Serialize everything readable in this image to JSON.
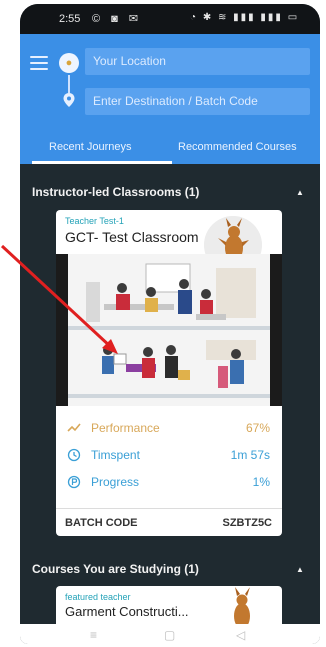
{
  "status_bar": {
    "time": "2:55"
  },
  "search": {
    "location_placeholder": "Your Location",
    "destination_placeholder": "Enter Destination / Batch Code"
  },
  "tabs": [
    {
      "label": "Recent Journeys",
      "active": true
    },
    {
      "label": "Recommended Courses",
      "active": false
    }
  ],
  "sections": {
    "instructor_led": {
      "title": "Instructor-led Classrooms (1)",
      "card": {
        "teacher": "Teacher Test-1",
        "title": "GCT- Test Classroom",
        "count": "1",
        "stats": [
          {
            "label": "Performance",
            "value": "67%"
          },
          {
            "label": "Timspent",
            "value": "1m 57s"
          },
          {
            "label": "Progress",
            "value": "1%"
          }
        ],
        "batch_label": "BATCH CODE",
        "batch_code": "SZBTZ5C"
      }
    },
    "studying": {
      "title": "Courses You are Studying (1)",
      "card": {
        "teacher": "featured teacher",
        "title": "Garment Constructi..."
      }
    }
  },
  "colors": {
    "header_blue": "#3b8fe6",
    "background_dark": "#1f2a30",
    "performance": "#d8a85a",
    "accent_teal": "#25a3b8",
    "annotation_red": "#e02020"
  }
}
